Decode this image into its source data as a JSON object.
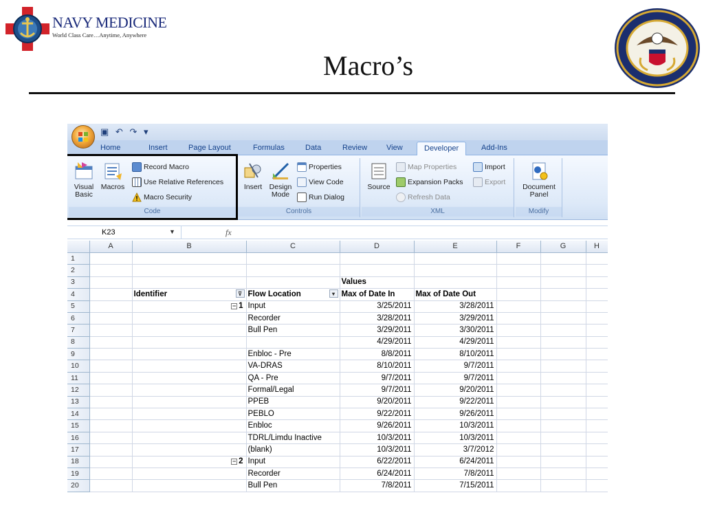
{
  "slide": {
    "logo_name": "NAVY MEDICINE",
    "logo_tagline": "World Class Care…Anytime, Anywhere",
    "title": "Macro’s"
  },
  "excel": {
    "ribbon_tabs": [
      "Home",
      "Insert",
      "Page Layout",
      "Formulas",
      "Data",
      "Review",
      "View",
      "Developer",
      "Add-Ins"
    ],
    "active_tab": "Developer",
    "groups": {
      "code": {
        "label": "Code",
        "visual_basic": "Visual Basic",
        "macros": "Macros",
        "record_macro": "Record Macro",
        "use_relative_references": "Use Relative References",
        "macro_security": "Macro Security"
      },
      "controls": {
        "label": "Controls",
        "insert": "Insert",
        "design_mode": "Design Mode",
        "properties": "Properties",
        "view_code": "View Code",
        "run_dialog": "Run Dialog"
      },
      "xml": {
        "label": "XML",
        "source": "Source",
        "map_properties": "Map Properties",
        "import": "Import",
        "expansion_packs": "Expansion Packs",
        "export": "Export",
        "refresh_data": "Refresh Data"
      },
      "modify": {
        "label": "Modify",
        "document_panel": "Document Panel"
      }
    },
    "name_box": "K23",
    "fx": "fx",
    "columns": [
      "A",
      "B",
      "C",
      "D",
      "E",
      "F",
      "G",
      "H"
    ],
    "pivot": {
      "values_label": "Values",
      "headers": [
        "Identifier",
        "Flow Location",
        "Max of Date In",
        "Max of Date Out"
      ],
      "rows": [
        {
          "row": "1",
          "id": "",
          "loc": "",
          "in": "",
          "out": ""
        },
        {
          "row": "2",
          "id": "",
          "loc": "",
          "in": "",
          "out": ""
        },
        {
          "row": "5",
          "id": "1",
          "loc": "Input",
          "in": "3/25/2011",
          "out": "3/28/2011"
        },
        {
          "row": "6",
          "id": "",
          "loc": "Recorder",
          "in": "3/28/2011",
          "out": "3/29/2011"
        },
        {
          "row": "7",
          "id": "",
          "loc": "Bull Pen",
          "in": "3/29/2011",
          "out": "3/30/2011"
        },
        {
          "row": "8",
          "id": "",
          "loc": "",
          "in": "4/29/2011",
          "out": "4/29/2011"
        },
        {
          "row": "9",
          "id": "",
          "loc": "Enbloc - Pre",
          "in": "8/8/2011",
          "out": "8/10/2011"
        },
        {
          "row": "10",
          "id": "",
          "loc": "VA-DRAS",
          "in": "8/10/2011",
          "out": "9/7/2011"
        },
        {
          "row": "11",
          "id": "",
          "loc": "QA - Pre",
          "in": "9/7/2011",
          "out": "9/7/2011"
        },
        {
          "row": "12",
          "id": "",
          "loc": "Formal/Legal",
          "in": "9/7/2011",
          "out": "9/20/2011"
        },
        {
          "row": "13",
          "id": "",
          "loc": "PPEB",
          "in": "9/20/2011",
          "out": "9/22/2011"
        },
        {
          "row": "14",
          "id": "",
          "loc": "PEBLO",
          "in": "9/22/2011",
          "out": "9/26/2011"
        },
        {
          "row": "15",
          "id": "",
          "loc": "Enbloc",
          "in": "9/26/2011",
          "out": "10/3/2011"
        },
        {
          "row": "16",
          "id": "",
          "loc": "TDRL/Limdu Inactive",
          "in": "10/3/2011",
          "out": "10/3/2011"
        },
        {
          "row": "17",
          "id": "",
          "loc": "(blank)",
          "in": "10/3/2011",
          "out": "3/7/2012"
        },
        {
          "row": "18",
          "id": "2",
          "loc": "Input",
          "in": "6/22/2011",
          "out": "6/24/2011"
        },
        {
          "row": "19",
          "id": "",
          "loc": "Recorder",
          "in": "6/24/2011",
          "out": "7/8/2011"
        },
        {
          "row": "20",
          "id": "",
          "loc": "Bull Pen",
          "in": "7/8/2011",
          "out": "7/15/2011"
        }
      ]
    }
  }
}
